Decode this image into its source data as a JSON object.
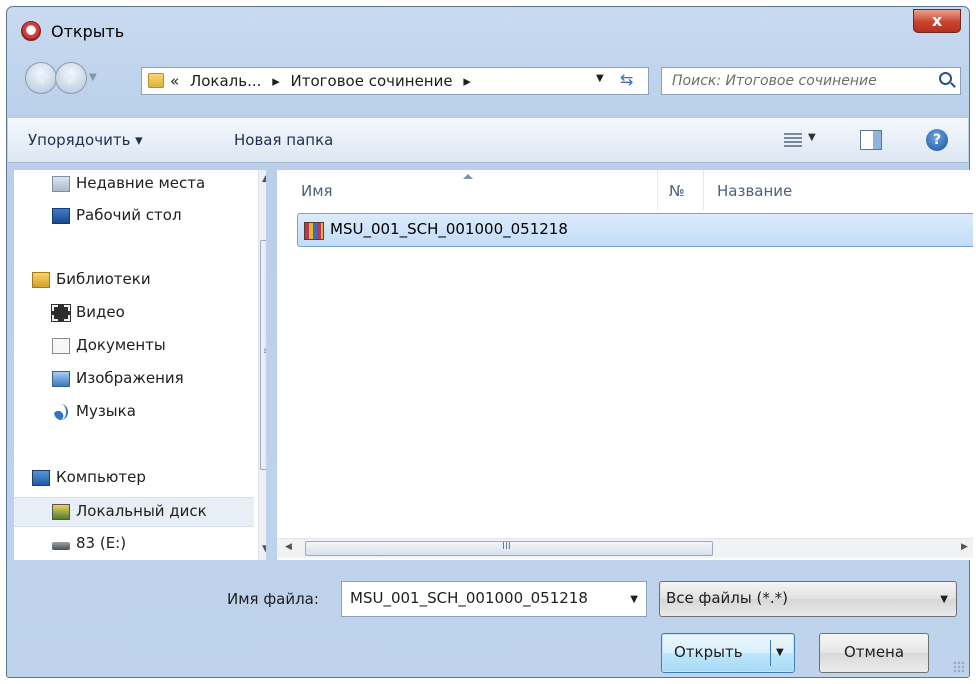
{
  "window": {
    "title": "Открыть",
    "close_label": "x"
  },
  "navbar": {
    "crumbs": [
      "«",
      "Локаль...",
      "▸",
      "Итоговое сочинение",
      "▸"
    ],
    "search_placeholder": "Поиск: Итоговое сочинение"
  },
  "toolbar": {
    "organize_label": "Упорядочить ▾",
    "new_folder_label": "Новая папка"
  },
  "nav_pane": {
    "items": [
      {
        "label": "Недавние места",
        "icon": "recent-places-icon"
      },
      {
        "label": "Рабочий стол",
        "icon": "desktop-icon"
      },
      {
        "label": "Библиотеки",
        "icon": "libraries-icon"
      },
      {
        "label": "Видео",
        "icon": "video-icon"
      },
      {
        "label": "Документы",
        "icon": "documents-icon"
      },
      {
        "label": "Изображения",
        "icon": "pictures-icon"
      },
      {
        "label": "Музыка",
        "icon": "music-icon"
      },
      {
        "label": "Компьютер",
        "icon": "computer-icon"
      },
      {
        "label": "Локальный диск",
        "icon": "local-disk-icon",
        "selected": true
      },
      {
        "label": "83 (E:)",
        "icon": "drive-icon"
      }
    ],
    "scroll_grip": "≡"
  },
  "content": {
    "columns": [
      "Имя",
      "№",
      "Название"
    ],
    "files": [
      {
        "name": "MSU_001_SCH_001000_051218",
        "icon": "archive-icon",
        "selected": true
      }
    ],
    "hscroll_grip": "III"
  },
  "bottom": {
    "filename_label": "Имя файла:",
    "filename_value": "MSU_001_SCH_001000_051218",
    "filetype_value": "Все файлы (*.*)",
    "open_label": "Открыть",
    "cancel_label": "Отмена"
  },
  "colors": {
    "accent": "#3c7fb1",
    "selection": "#c2dcf7",
    "frame": "#bfd3ec"
  }
}
